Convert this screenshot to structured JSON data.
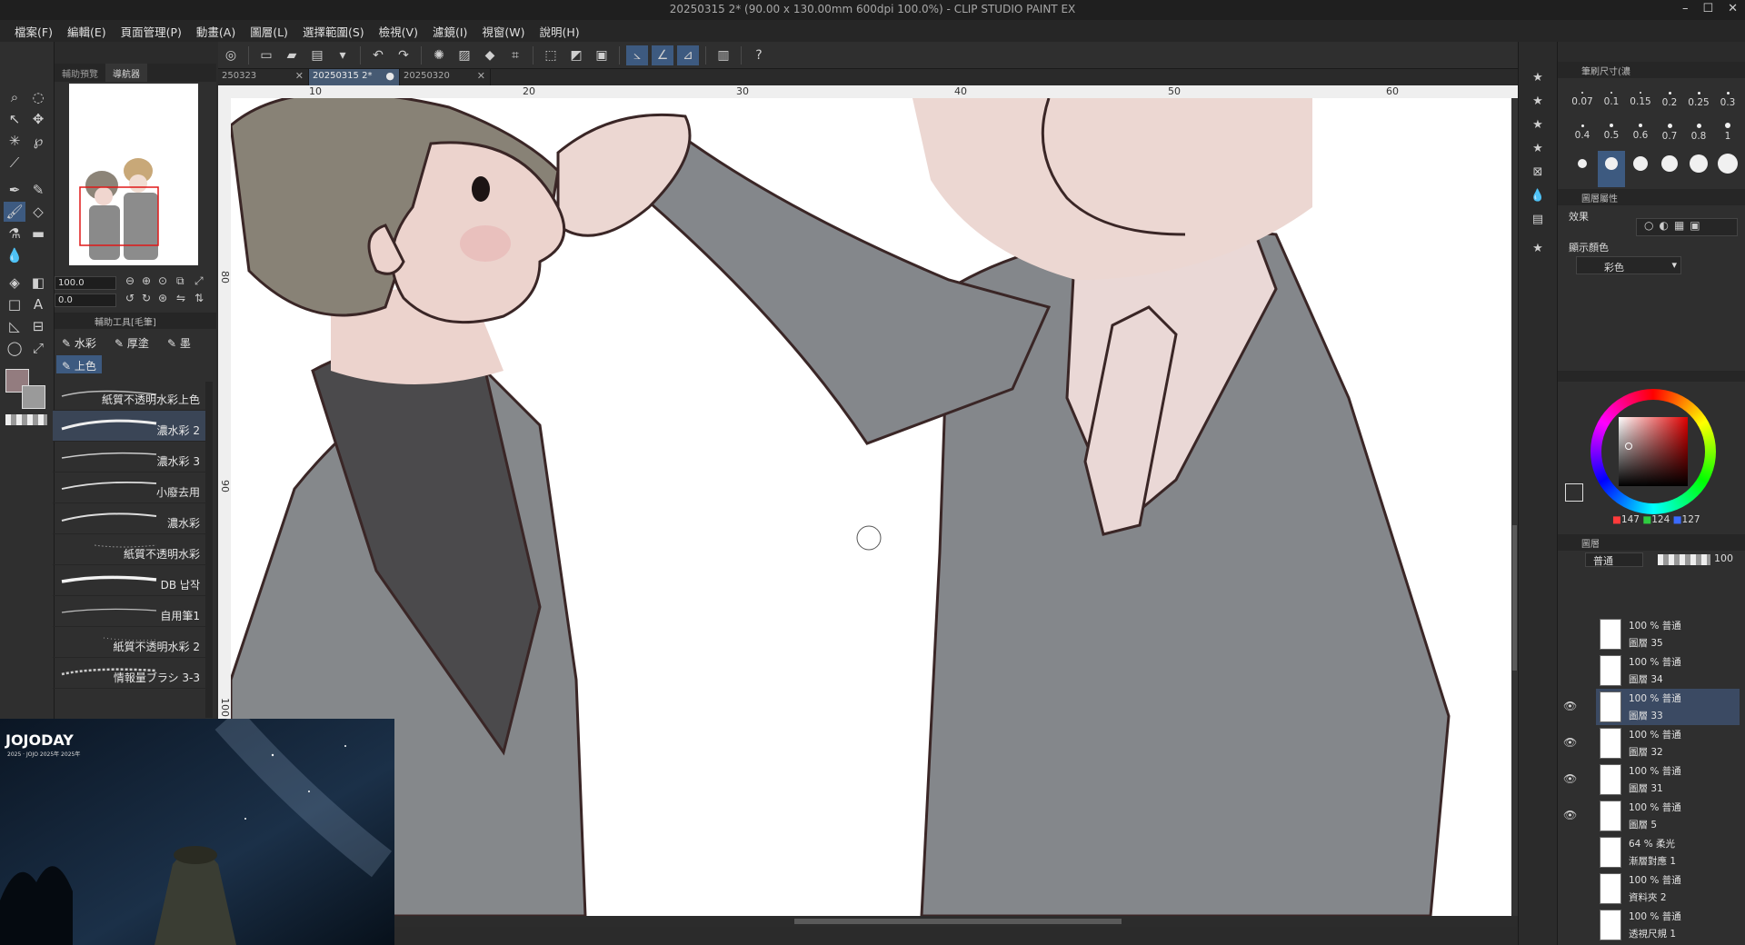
{
  "window": {
    "title": "20250315 2* (90.00 x 130.00mm 600dpi 100.0%) - CLIP STUDIO PAINT EX",
    "min_icon": "minimize-icon",
    "max_icon": "maximize-icon",
    "close_icon": "close-icon"
  },
  "menu": [
    "檔案(F)",
    "編輯(E)",
    "頁面管理(P)",
    "動畫(A)",
    "圖層(L)",
    "選擇範圍(S)",
    "檢視(V)",
    "濾鏡(I)",
    "視窗(W)",
    "說明(H)"
  ],
  "navigator": {
    "tabs": [
      "輔助預覽",
      "導航器"
    ],
    "zoom": "100.0",
    "rotate": "0.0"
  },
  "subtool": {
    "header": "輔助工具[毛筆]",
    "groups": [
      "水彩",
      "厚塗",
      "墨"
    ],
    "active_group": "上色",
    "brushes": [
      "紙質不透明水彩上色",
      "濃水彩 2",
      "濃水彩 3",
      "小廢去用",
      "濃水彩",
      "紙質不透明水彩",
      "DB 납작",
      "自用筆1",
      "紙質不透明水彩 2",
      "情報量ブラシ 3-3"
    ],
    "selected_brush_index": 1
  },
  "video": {
    "logo": "JOJODAY",
    "logo_sub": "2025 · JOJO 2025年 2025年"
  },
  "tabs": [
    {
      "label": "250323",
      "active": false
    },
    {
      "label": "20250315 2*",
      "active": true
    },
    {
      "label": "20250320",
      "active": false
    }
  ],
  "ruler": {
    "top": [
      "10",
      "20",
      "30",
      "40",
      "50",
      "60"
    ],
    "left": [
      "80",
      "90",
      "100"
    ]
  },
  "brush_size": {
    "header": "筆刷尺寸(濃",
    "values": [
      "0.07",
      "0.1",
      "0.15",
      "0.2",
      "0.25",
      "0.3",
      "0.4",
      "0.5",
      "0.6",
      "0.7",
      "0.8",
      "1"
    ],
    "selected_index": 13
  },
  "layer_property": {
    "header": "圖層屬性",
    "effect_label": "效果",
    "display_color_label": "顯示顏色",
    "display_color_value": "彩色"
  },
  "color": {
    "r": "147",
    "g": "124",
    "b": "127",
    "main_hex": "#937c7f",
    "sub_hex": "#9a9a9a"
  },
  "layers_panel": {
    "header": "圖層",
    "blend": "普通",
    "opacity": "100",
    "rows": [
      {
        "mode": "100 % 普通",
        "name": "圖層 35",
        "selected": false,
        "visible": false
      },
      {
        "mode": "100 % 普通",
        "name": "圖層 34",
        "selected": false,
        "visible": false
      },
      {
        "mode": "100 % 普通",
        "name": "圖層 33",
        "selected": true,
        "visible": true
      },
      {
        "mode": "100 % 普通",
        "name": "圖層 32",
        "selected": false,
        "visible": true
      },
      {
        "mode": "100 % 普通",
        "name": "圖層 31",
        "selected": false,
        "visible": true
      },
      {
        "mode": "100 % 普通",
        "name": "圖層 5",
        "selected": false,
        "visible": true
      },
      {
        "mode": "64 % 柔光",
        "name": "漸層對應 1",
        "selected": false,
        "visible": false
      },
      {
        "mode": "100 % 普通",
        "name": "資料夾 2",
        "selected": false,
        "visible": false
      },
      {
        "mode": "100 % 普通",
        "name": "透視尺規 1",
        "selected": false,
        "visible": false
      }
    ]
  }
}
